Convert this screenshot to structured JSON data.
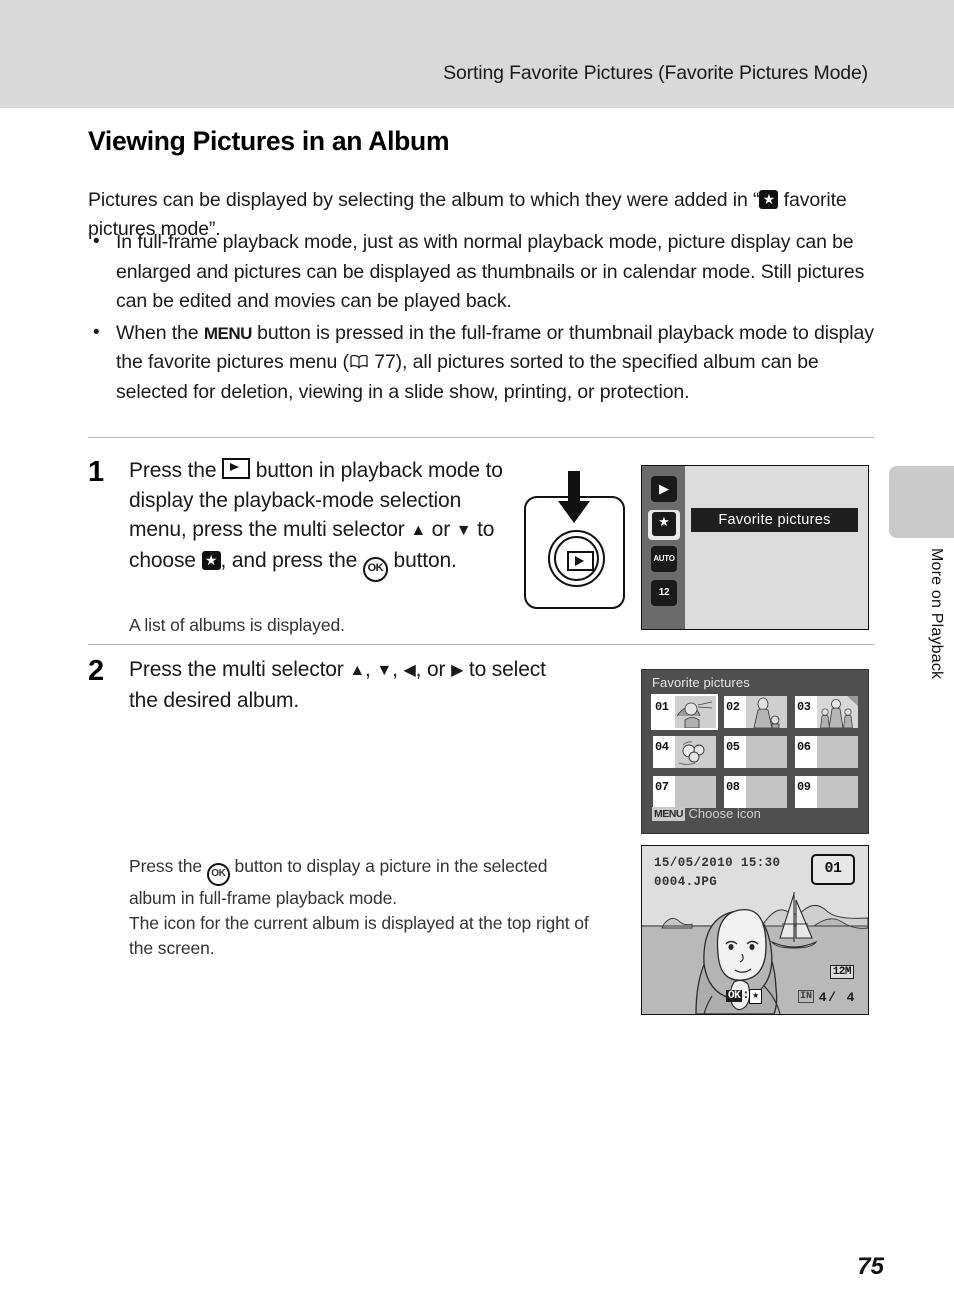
{
  "header": {
    "running_title": "Sorting Favorite Pictures (Favorite Pictures Mode)"
  },
  "side_tab": {
    "label": "More on Playback"
  },
  "section": {
    "title": "Viewing Pictures in an Album",
    "intro_part1": "Pictures can be displayed by selecting the album to which they were added in “",
    "intro_part2": " favorite pictures mode”.",
    "bullets": [
      {
        "text": "In full-frame playback mode, just as with normal playback mode, picture display can be enlarged and pictures can be displayed as thumbnails or in calendar mode. Still pictures can be edited and movies can be played back."
      },
      {
        "seg1": "When the ",
        "menu_label": "MENU",
        "seg2": " button is pressed in the full-frame or thumbnail playback mode to display the favorite pictures menu (",
        "page_ref": " 77",
        "seg3": "), all pictures sorted to the specified album can be selected for deletion, viewing in a slide show, printing, or protection."
      }
    ]
  },
  "steps": [
    {
      "number": "1",
      "seg1": "Press the ",
      "seg2": " button in playback mode to display the playback-mode selection menu, press the multi selector ",
      "up_arrow": "▲",
      "seg3": " or ",
      "down_arrow": "▼",
      "seg4": " to choose ",
      "seg5": ", and press the ",
      "ok_label": "OK",
      "seg6": " button.",
      "note": "A list of albums is displayed."
    },
    {
      "number": "2",
      "seg1": "Press the multi selector ",
      "arrows": [
        "▲",
        "▼",
        "◀",
        "▶"
      ],
      "seg2": " to select the desired album."
    }
  ],
  "tail_paragraphs": [
    {
      "seg1": "Press the ",
      "ok_label": "OK",
      "seg2": " button to display a picture in the selected album in full-frame playback mode."
    },
    {
      "text": "The icon for the current album is displayed at the top right of the screen."
    }
  ],
  "screen_playback_mode": {
    "rail_icons": [
      {
        "name": "playback-icon",
        "glyph": "▶",
        "selected": false
      },
      {
        "name": "favorite-pictures-icon",
        "glyph": "★",
        "selected": true
      },
      {
        "name": "auto-sort-icon",
        "glyph": "AUTO",
        "selected": false
      },
      {
        "name": "list-by-date-icon",
        "glyph": "12",
        "selected": false
      }
    ],
    "highlighted_item": "Favorite pictures"
  },
  "screen_album_grid": {
    "title": "Favorite pictures",
    "albums": [
      {
        "number": "01",
        "has_thumbnail": true,
        "selected": true
      },
      {
        "number": "02",
        "has_thumbnail": true,
        "selected": false
      },
      {
        "number": "03",
        "has_thumbnail": true,
        "selected": false
      },
      {
        "number": "04",
        "has_thumbnail": true,
        "selected": false
      },
      {
        "number": "05",
        "has_thumbnail": false,
        "selected": false
      },
      {
        "number": "06",
        "has_thumbnail": false,
        "selected": false
      },
      {
        "number": "07",
        "has_thumbnail": false,
        "selected": false
      },
      {
        "number": "08",
        "has_thumbnail": false,
        "selected": false
      },
      {
        "number": "09",
        "has_thumbnail": false,
        "selected": false
      }
    ],
    "footer_chip": "MENU",
    "footer_text": "Choose icon"
  },
  "screen_full_frame": {
    "date": "15/05/2010 15:30",
    "filename": "0004.JPG",
    "album_badge": "01",
    "image_size": "12M",
    "frame_count": "4/  4",
    "ok_chip": "OK",
    "ok_separator": ":",
    "ok_star": "★",
    "internal_memory": "IN"
  },
  "footer": {
    "page_number": "75"
  },
  "colors": {
    "header_band": "#d9d9d9",
    "side_tab": "#c9c9c9",
    "screen_bg_light": "#dcdcdc",
    "screen_bg_dark": "#4f4f4f",
    "rail": "#6b6b6b",
    "highlight": "#1f1f1f"
  }
}
